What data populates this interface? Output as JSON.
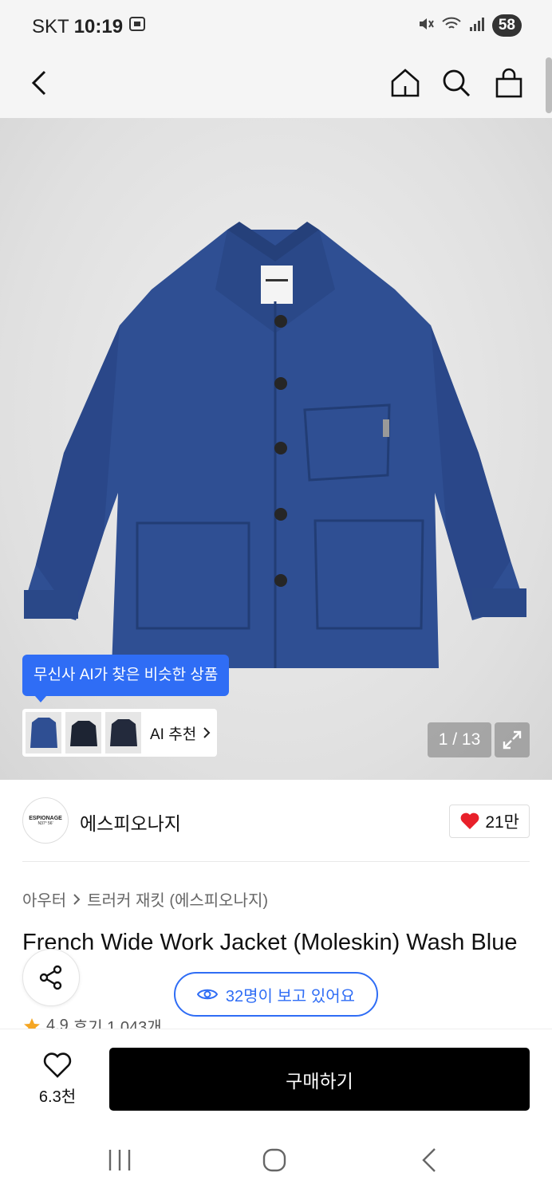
{
  "status": {
    "carrier": "SKT",
    "time": "10:19",
    "battery": "58",
    "icons": [
      "screenshot-icon",
      "mute-icon",
      "wifi-icon",
      "signal-icon"
    ]
  },
  "nav": {
    "icons": [
      "back-icon",
      "home-icon",
      "search-icon",
      "cart-icon"
    ]
  },
  "hero": {
    "ai_tooltip": "무신사 AI가 찾은 비슷한 상품",
    "ai_recommend": "AI 추천",
    "pager": "1 / 13",
    "product_color": "#2f4f93"
  },
  "brand": {
    "logo_text": "ESPIONAGE",
    "logo_sub": "N37° 56'",
    "name": "에스피오나지",
    "likes": "21만"
  },
  "breadcrumb": {
    "category": "아우터",
    "subcategory": "트러커 재킷 (에스피오나지)"
  },
  "product": {
    "title": "French Wide Work Jacket (Moleskin) Wash Blue",
    "rating": "4.9",
    "reviews": "후기 1,043개"
  },
  "overlay": {
    "viewers": "32명이 보고 있어요"
  },
  "bottom": {
    "wish_count": "6.3천",
    "buy_label": "구매하기"
  },
  "colors": {
    "accent": "#2f6df5",
    "heart": "#e8202a",
    "star": "#f5a623"
  }
}
